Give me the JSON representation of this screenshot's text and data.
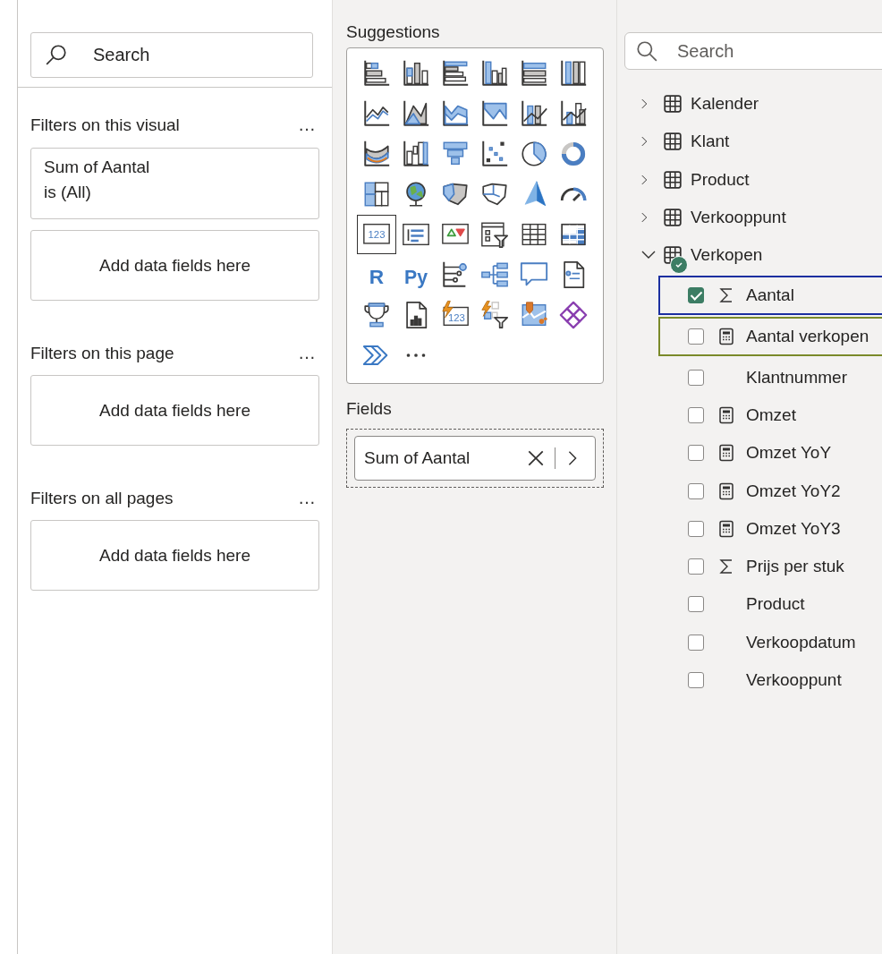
{
  "filters_pane": {
    "search": {
      "placeholder": "Search"
    },
    "sections": [
      {
        "title": "Filters on this visual",
        "more": "…",
        "cards": [
          {
            "kind": "filter",
            "title": "Sum of Aantal",
            "condition": "is (All)"
          },
          {
            "kind": "drop",
            "text": "Add data fields here"
          }
        ]
      },
      {
        "title": "Filters on this page",
        "more": "…",
        "cards": [
          {
            "kind": "drop",
            "text": "Add data fields here"
          }
        ]
      },
      {
        "title": "Filters on all pages",
        "more": "…",
        "cards": [
          {
            "kind": "drop",
            "text": "Add data fields here"
          }
        ]
      }
    ]
  },
  "visualizations": {
    "suggestions_label": "Suggestions",
    "visuals": [
      {
        "kind": "hbar-stacked",
        "selected": false
      },
      {
        "kind": "col-stacked",
        "selected": false
      },
      {
        "kind": "hbar-clustered",
        "selected": false
      },
      {
        "kind": "col-clustered",
        "selected": false
      },
      {
        "kind": "hbar-100",
        "selected": false
      },
      {
        "kind": "col-100",
        "selected": false
      },
      {
        "kind": "line",
        "selected": false
      },
      {
        "kind": "area",
        "selected": false
      },
      {
        "kind": "stacked-area",
        "selected": false
      },
      {
        "kind": "area-100",
        "selected": false
      },
      {
        "kind": "line-col-stacked",
        "selected": false
      },
      {
        "kind": "line-col-clustered",
        "selected": false
      },
      {
        "kind": "ribbon",
        "selected": false
      },
      {
        "kind": "waterfall",
        "selected": false
      },
      {
        "kind": "funnel",
        "selected": false
      },
      {
        "kind": "scatter",
        "selected": false
      },
      {
        "kind": "pie",
        "selected": false
      },
      {
        "kind": "donut",
        "selected": false
      },
      {
        "kind": "treemap",
        "selected": false
      },
      {
        "kind": "globe",
        "selected": false
      },
      {
        "kind": "filled-map",
        "selected": false
      },
      {
        "kind": "shape-map",
        "selected": false
      },
      {
        "kind": "arrow",
        "selected": false
      },
      {
        "kind": "gauge",
        "selected": false
      },
      {
        "kind": "card",
        "label": "123",
        "selected": true
      },
      {
        "kind": "multirow-card",
        "selected": false
      },
      {
        "kind": "kpi",
        "selected": false
      },
      {
        "kind": "slicer",
        "selected": false
      },
      {
        "kind": "table",
        "selected": false
      },
      {
        "kind": "matrix",
        "selected": false
      },
      {
        "kind": "script",
        "label": "R",
        "selected": false
      },
      {
        "kind": "script",
        "label": "Py",
        "selected": false
      },
      {
        "kind": "influencers",
        "selected": false
      },
      {
        "kind": "decomposition",
        "selected": false
      },
      {
        "kind": "speech",
        "selected": false
      },
      {
        "kind": "narrative",
        "selected": false
      },
      {
        "kind": "trophy",
        "selected": false
      },
      {
        "kind": "paginated",
        "selected": false
      },
      {
        "kind": "card-new",
        "label": "123",
        "selected": false
      },
      {
        "kind": "slicer-new",
        "selected": false
      },
      {
        "kind": "pin-map",
        "selected": false
      },
      {
        "kind": "diamonds",
        "selected": false
      },
      {
        "kind": "chevron",
        "selected": false
      },
      {
        "kind": "more",
        "selected": false
      }
    ],
    "fields_label": "Fields",
    "wells": [
      {
        "label": "Sum of Aantal"
      }
    ]
  },
  "data_pane": {
    "search": {
      "placeholder": "Search"
    },
    "tables": [
      {
        "name": "Kalender",
        "expanded": false,
        "in_use": false
      },
      {
        "name": "Klant",
        "expanded": false,
        "in_use": false
      },
      {
        "name": "Product",
        "expanded": false,
        "in_use": false
      },
      {
        "name": "Verkooppunt",
        "expanded": false,
        "in_use": false
      },
      {
        "name": "Verkopen",
        "expanded": true,
        "in_use": true,
        "children": [
          {
            "name": "Aantal",
            "kind": "sum",
            "checked": true,
            "color": "#1b2fa0"
          },
          {
            "name": "Aantal verkopen",
            "kind": "measure",
            "checked": false,
            "color": "#7a8a2a"
          },
          {
            "name": "Klantnummer",
            "kind": "field",
            "checked": false
          },
          {
            "name": "Omzet",
            "kind": "measure",
            "checked": false
          },
          {
            "name": "Omzet YoY",
            "kind": "measure",
            "checked": false
          },
          {
            "name": "Omzet YoY2",
            "kind": "measure",
            "checked": false
          },
          {
            "name": "Omzet YoY3",
            "kind": "measure",
            "checked": false
          },
          {
            "name": "Prijs per stuk",
            "kind": "sum",
            "checked": false
          },
          {
            "name": "Product",
            "kind": "field",
            "checked": false
          },
          {
            "name": "Verkoopdatum",
            "kind": "field",
            "checked": false
          },
          {
            "name": "Verkooppunt",
            "kind": "field",
            "checked": false
          }
        ]
      }
    ]
  }
}
